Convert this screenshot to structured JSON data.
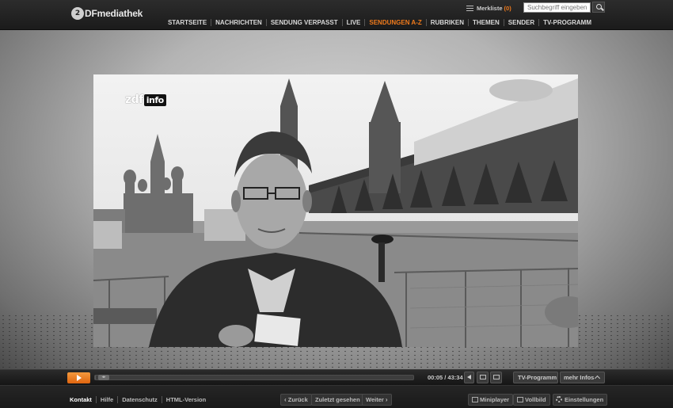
{
  "header": {
    "logo_mark": "2",
    "logo_text": "DFmediathek",
    "merkliste_label": "Merkliste",
    "merkliste_count": "(0)",
    "search_placeholder": "Suchbegriff eingeben",
    "nav": [
      {
        "label": "STARTSEITE",
        "active": false
      },
      {
        "label": "NACHRICHTEN",
        "active": false
      },
      {
        "label": "SENDUNG VERPASST",
        "active": false
      },
      {
        "label": "LIVE",
        "active": false
      },
      {
        "label": "SENDUNGEN A-Z",
        "active": true
      },
      {
        "label": "RUBRIKEN",
        "active": false
      },
      {
        "label": "THEMEN",
        "active": false
      },
      {
        "label": "SENDER",
        "active": false
      },
      {
        "label": "TV-PROGRAMM",
        "active": false
      }
    ]
  },
  "video": {
    "channel_logo_zdf": "zdf",
    "channel_logo_info": "info"
  },
  "player": {
    "time": "00:05 / 43:34",
    "progress_fraction": 0.002,
    "tv_programm_label": "TV-Programm",
    "more_info_label": "mehr Infos"
  },
  "footer": {
    "links": [
      "Kontakt",
      "Hilfe",
      "Datenschutz",
      "HTML-Version"
    ],
    "back_label": "Zurück",
    "recent_label": "Zuletzt gesehen",
    "next_label": "Weiter",
    "miniplayer_label": "Miniplayer",
    "vollbild_label": "Vollbild",
    "settings_label": "Einstellungen"
  },
  "colors": {
    "accent": "#f07a1b"
  }
}
